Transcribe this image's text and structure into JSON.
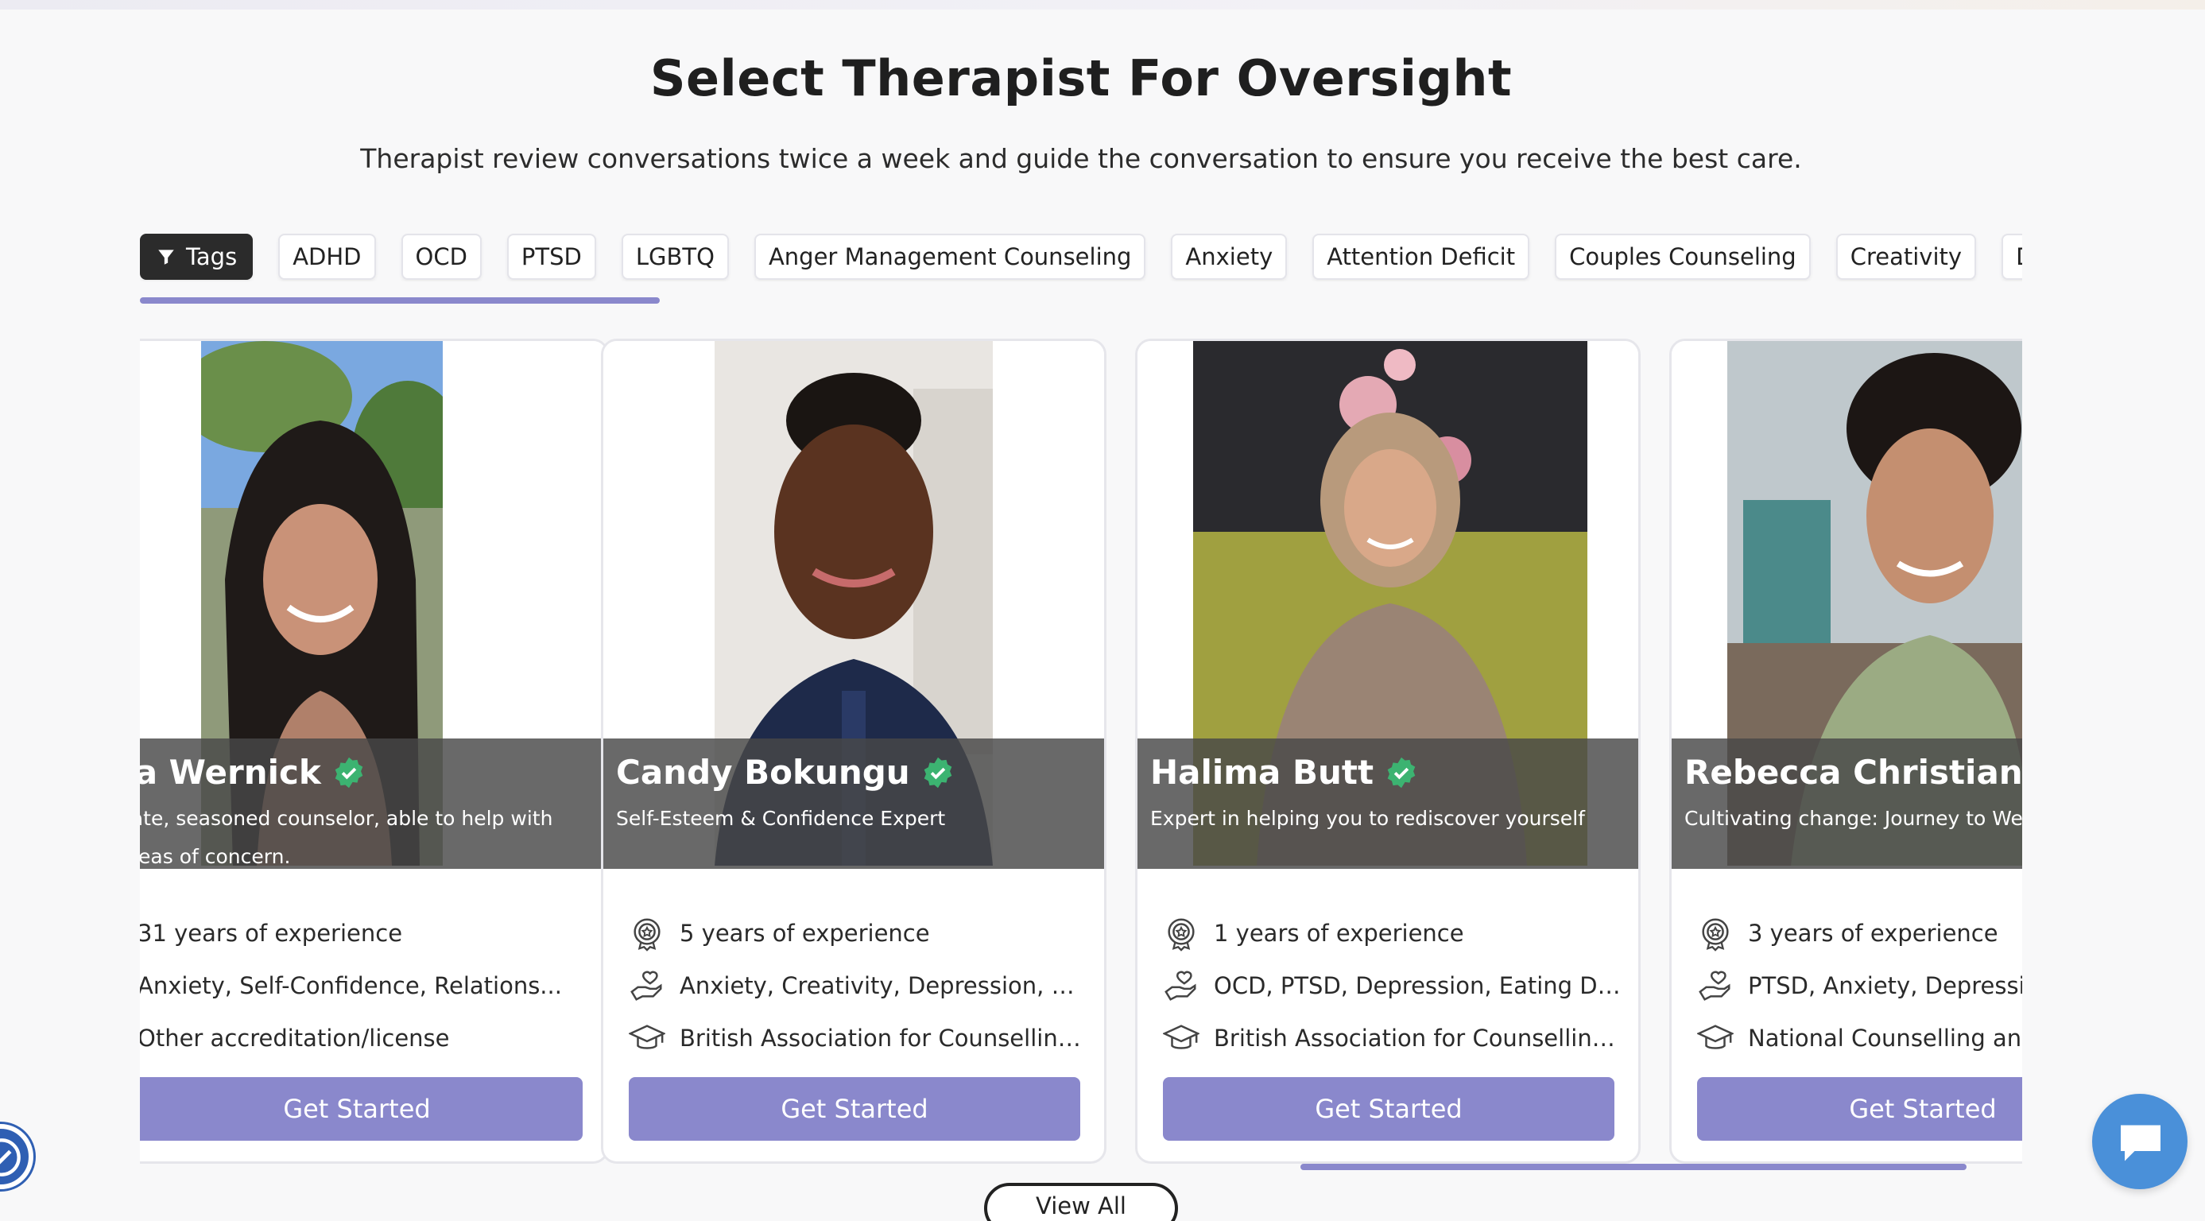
{
  "header": {
    "title": "Select Therapist For Oversight",
    "subtitle": "Therapist review conversations twice a week and guide the conversation to ensure you receive the best care."
  },
  "filters": {
    "primary_label": "Tags",
    "primary_icon": "filter-icon",
    "tags": [
      "ADHD",
      "OCD",
      "PTSD",
      "LGBTQ",
      "Anger Management Counseling",
      "Anxiety",
      "Attention Deficit",
      "Couples Counseling",
      "Creativity",
      "Depre"
    ]
  },
  "therapists": [
    {
      "name": "ra Wernick",
      "tagline": "nate, seasoned counselor, able to help with areas of concern.",
      "experience": "31 years of experience",
      "specialties": "Anxiety, Self-Confidence, Relations...",
      "accreditation": "Other accreditation/license",
      "cta": "Get Started"
    },
    {
      "name": "Candy Bokungu",
      "tagline": "Self-Esteem & Confidence Expert",
      "experience": "5 years of experience",
      "specialties": "Anxiety, Creativity, Depression, Multi...",
      "accreditation": "British Association for Counselling ...",
      "cta": "Get Started"
    },
    {
      "name": "Halima Butt",
      "tagline": "Expert in helping you to rediscover yourself",
      "experience": "1 years of experience",
      "specialties": "OCD, PTSD, Depression, Eating Disor...",
      "accreditation": "British Association for Counselling ...",
      "cta": "Get Started"
    },
    {
      "name": "Rebecca Christian",
      "tagline": "Cultivating change: Journey to Well Rebecca",
      "experience": "3 years of experience",
      "specialties": "PTSD, Anxiety, Depression",
      "accreditation": "National Counselling and",
      "cta": "Get Started"
    }
  ],
  "view_all_label": "View All",
  "colors": {
    "accent": "#8a88cc",
    "verified": "#3cb371",
    "dark_tag": "#2b2b2b",
    "chat": "#4a90d9"
  },
  "icons": {
    "experience": "award-badge-icon",
    "specialties": "heart-hand-icon",
    "accreditation": "graduation-cap-icon",
    "verified": "verified-badge-icon",
    "chat": "chat-bubble-icon",
    "accessibility": "accessibility-icon"
  }
}
